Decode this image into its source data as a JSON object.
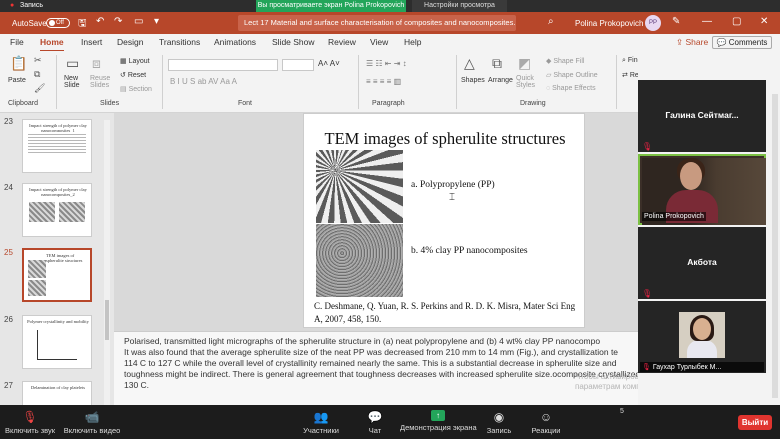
{
  "meeting_banner": {
    "recording_label": "Запись",
    "view_notice": "Вы просматриваете экран Polina Prokopovich",
    "view_settings": "Настройки просмотра"
  },
  "titlebar": {
    "autosave_label": "AutoSave",
    "autosave_state": "Off",
    "doc_title": "Lect 17 Material and surface characterisation of composites and nanocomposites....",
    "user_name": "Polina Prokopovich",
    "user_initials": "PP"
  },
  "tabs": [
    "File",
    "Home",
    "Insert",
    "Design",
    "Transitions",
    "Animations",
    "Slide Show",
    "Review",
    "View",
    "Help"
  ],
  "actions": {
    "share": "Share",
    "comments": "Comments"
  },
  "ribbon": {
    "paste": "Paste",
    "new_slide": "New Slide",
    "reuse_slides": "Reuse Slides",
    "layout": "Layout",
    "reset": "Reset",
    "section": "Section",
    "shapes": "Shapes",
    "arrange": "Arrange",
    "quick_styles": "Quick Styles",
    "shape_fill": "Shape Fill",
    "shape_outline": "Shape Outline",
    "shape_effects": "Shape Effects",
    "find": "Find",
    "replace": "Replace",
    "groups": {
      "clipboard": "Clipboard",
      "slides": "Slides",
      "font": "Font",
      "paragraph": "Paragraph",
      "drawing": "Drawing"
    }
  },
  "thumbnails": [
    {
      "number": "23",
      "title": "Impact strength of polymer clay nanocomposites_1"
    },
    {
      "number": "24",
      "title": "Impact strength of polymer clay nanocomposites_2"
    },
    {
      "number": "25",
      "title": "TEM images of spherulite structures"
    },
    {
      "number": "26",
      "title": "Polymer crystallinity and mobility"
    },
    {
      "number": "27",
      "title": "Delamination of clay platelets"
    }
  ],
  "slide": {
    "title": "TEM images of spherulite structures",
    "label_pp": "a. Polypropylene (PP)",
    "label_clay": "b. 4% clay PP nanocomposites",
    "citation": "C. Deshmane, Q. Yuan, R. S. Perkins and R. D. K. Misra, Mater Sci Eng A, 2007, 458, 150."
  },
  "notes": "Polarised, transmitted light micrographs of the spherulite structure in (a) neat polypropylene and (b) 4 wt% clay PP nanocompo\nIt was also found that the average spherulite size of the neat PP was decreased from 210 mm to 14 mm (Fig.), and crystallization te\n114 C to 127 C while the overall level of crystallinity remained nearly the same. This is a substantial decrease in spherulite size and\ntoughness might be indirect. There is general agreement that toughness decreases with increased spherulite size.ocomposite crystallized at 130 C.",
  "watermark": "Чтобы активировать Windows, перейдите к параметрам компьютера.",
  "participants_panel": {
    "tile1_name": "Галина Сейтмаг...",
    "video_name": "Polina Prokopovich",
    "tile3_name": "Акбота",
    "small_name": "Гаухар Турлыбек М..."
  },
  "meeting_toolbar": {
    "mic": "Включить звук",
    "video": "Включить видео",
    "participants": "Участники",
    "participants_count": "5",
    "chat": "Чат",
    "share_screen": "Демонстрация экрана",
    "record": "Запись",
    "reactions": "Реакции",
    "leave": "Выйти"
  }
}
